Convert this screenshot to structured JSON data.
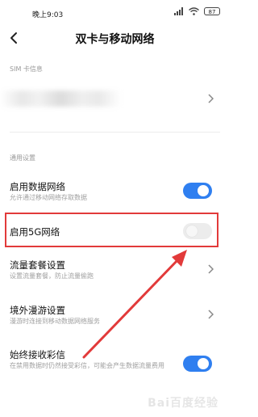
{
  "status_bar": {
    "time": "晚上9:03",
    "battery": "87"
  },
  "header": {
    "title": "双卡与移动网络"
  },
  "sim_section": {
    "label": "SIM 卡信息"
  },
  "general_section": {
    "label": "通用设置"
  },
  "settings": {
    "data_network": {
      "title": "启用数据网络",
      "subtitle": "允许通过移动网络存取数据",
      "enabled": true
    },
    "enable_5g": {
      "title": "启用5G网络",
      "enabled": false
    },
    "data_plan": {
      "title": "流量套餐设置",
      "subtitle": "设置流量套餐，防止流量偷跑"
    },
    "roaming": {
      "title": "境外漫游设置",
      "subtitle": "漫游时连接到移动数据网络服务"
    },
    "mms": {
      "title": "始终接收彩信",
      "subtitle": "在禁用数据时仍然接受彩信，可能会产生数据流量费用",
      "enabled": true
    }
  },
  "watermark": "Bai百度经验",
  "colors": {
    "accent": "#2f7ff0",
    "highlight": "#e23a3a"
  }
}
